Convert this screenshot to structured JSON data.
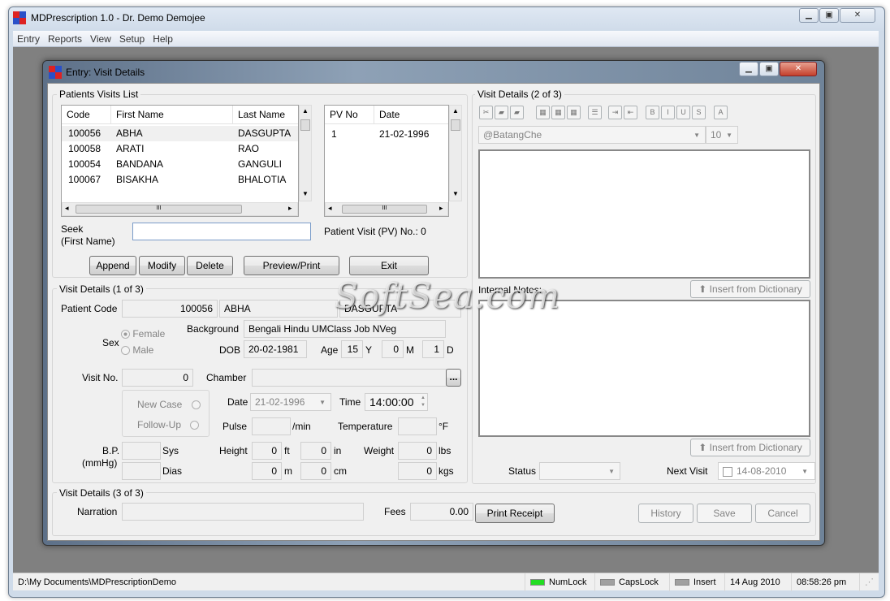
{
  "app": {
    "title": "MDPrescription 1.0 - Dr. Demo Demojee",
    "menu": [
      "Entry",
      "Reports",
      "View",
      "Setup",
      "Help"
    ]
  },
  "child": {
    "title": "Entry: Visit Details"
  },
  "patients": {
    "group": "Patients Visits List",
    "columns": [
      "Code",
      "First Name",
      "Last Name"
    ],
    "rows": [
      [
        "100056",
        "ABHA",
        "DASGUPTA"
      ],
      [
        "100058",
        "ARATI",
        "RAO"
      ],
      [
        "100054",
        "BANDANA",
        "GANGULI"
      ],
      [
        "100067",
        "BISAKHA",
        "BHALOTIA"
      ]
    ]
  },
  "visits": {
    "columns": [
      "PV No",
      "Date"
    ],
    "rows": [
      [
        "1",
        "21-02-1996"
      ]
    ]
  },
  "seek": {
    "label1": "Seek",
    "label2": "(First Name)",
    "value": "",
    "pv_label": "Patient Visit (PV) No.: 0"
  },
  "buttons": {
    "append": "Append",
    "modify": "Modify",
    "delete": "Delete",
    "preview": "Preview/Print",
    "exit": "Exit",
    "print_receipt": "Print Receipt",
    "history": "History",
    "save": "Save",
    "cancel": "Cancel",
    "insert_dict": "Insert from Dictionary",
    "ellipsis": "..."
  },
  "vd1": {
    "group": "Visit Details (1 of 3)",
    "patient_code_label": "Patient Code",
    "patient_code": "100056",
    "first": "ABHA",
    "last": "DASGUPTA",
    "sex_label": "Sex",
    "female": "Female",
    "male": "Male",
    "background_label": "Background",
    "background": "Bengali Hindu UMClass Job NVeg",
    "dob_label": "DOB",
    "dob": "20-02-1981",
    "age_label": "Age",
    "age_y": "15",
    "y": "Y",
    "age_m": "0",
    "m": "M",
    "age_d": "1",
    "d": "D",
    "visit_no_label": "Visit No.",
    "visit_no": "0",
    "chamber_label": "Chamber",
    "new_case": "New Case",
    "follow_up": "Follow-Up",
    "date_label": "Date",
    "date": "21-02-1996",
    "time_label": "Time",
    "time": "14:00:00",
    "pulse_label": "Pulse",
    "pulse_unit": "/min",
    "temp_label": "Temperature",
    "temp_unit": "°F",
    "bp_label1": "B.P.",
    "bp_label2": "(mmHg)",
    "sys": "Sys",
    "dias": "Dias",
    "height_label": "Height",
    "ft": "0",
    "ft_unit": "ft",
    "in": "0",
    "in_unit": "in",
    "m_val": "0",
    "m_unit": "m",
    "cm": "0",
    "cm_unit": "cm",
    "weight_label": "Weight",
    "lbs": "0",
    "lbs_unit": "lbs",
    "kgs": "0",
    "kgs_unit": "kgs"
  },
  "vd2": {
    "group": "Visit Details (2 of 3)",
    "font": "@BatangChe",
    "size": "10",
    "internal_notes": "Internal Notes:",
    "status_label": "Status",
    "next_visit_label": "Next Visit",
    "next_visit": "14-08-2010"
  },
  "vd3": {
    "group": "Visit Details (3 of 3)",
    "narration_label": "Narration",
    "fees_label": "Fees",
    "fees": "0.00"
  },
  "statusbar": {
    "path": "D:\\My Documents\\MDPrescriptionDemo",
    "numlock": "NumLock",
    "capslock": "CapsLock",
    "insert": "Insert",
    "date": "14 Aug 2010",
    "time": "08:58:26 pm",
    "numlock_color": "#22dd22",
    "off_color": "#a0a0a0"
  },
  "watermark": "SoftSea.com"
}
